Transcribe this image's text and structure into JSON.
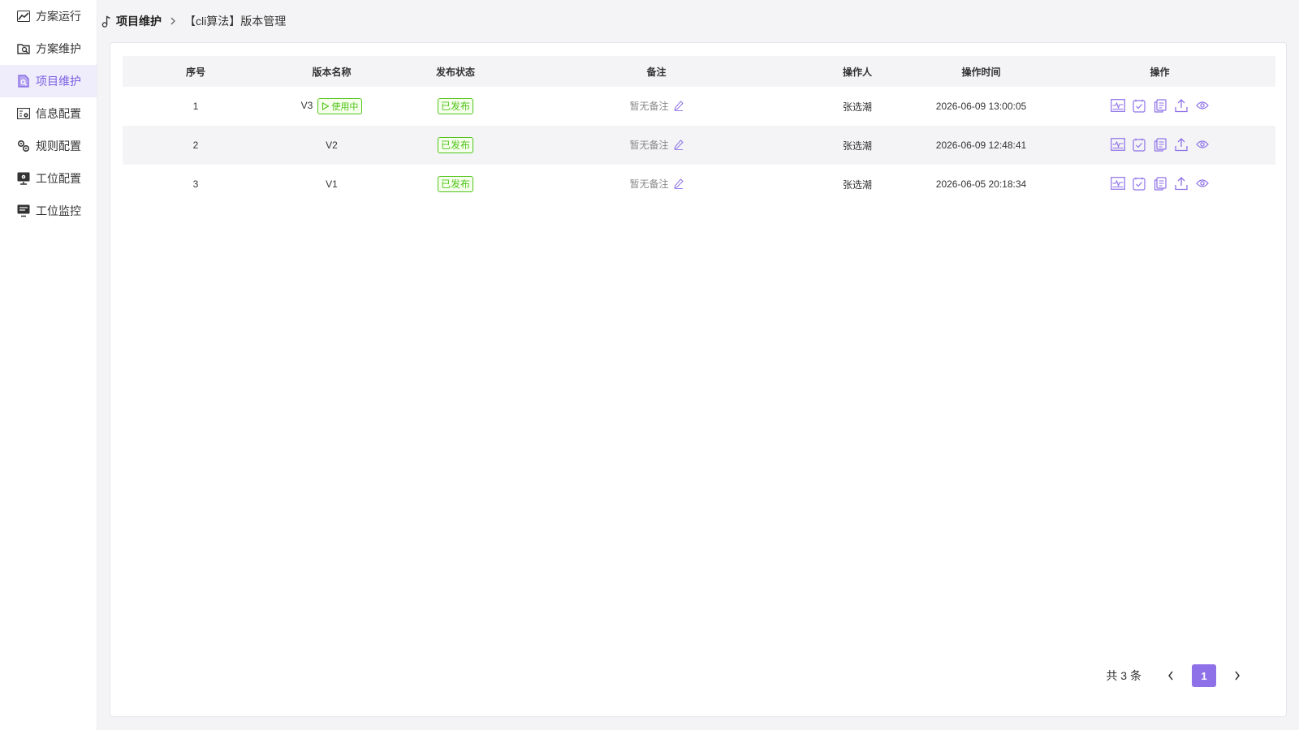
{
  "sidebar": {
    "items": [
      {
        "label": "方案运行",
        "icon": "chart-line-icon",
        "active": false
      },
      {
        "label": "方案维护",
        "icon": "folder-search-icon",
        "active": false
      },
      {
        "label": "项目维护",
        "icon": "document-search-icon",
        "active": true
      },
      {
        "label": "信息配置",
        "icon": "settings-board-icon",
        "active": false
      },
      {
        "label": "规则配置",
        "icon": "gears-icon",
        "active": false
      },
      {
        "label": "工位配置",
        "icon": "monitor-gear-icon",
        "active": false
      },
      {
        "label": "工位监控",
        "icon": "monitor-list-icon",
        "active": false
      }
    ]
  },
  "breadcrumb": {
    "parent": "项目维护",
    "current": "【cli算法】版本管理"
  },
  "table": {
    "headers": [
      "序号",
      "版本名称",
      "发布状态",
      "备注",
      "操作人",
      "操作时间",
      "操作"
    ],
    "rows": [
      {
        "seq": "1",
        "name": "V3",
        "badge": "使用中",
        "status": "已发布",
        "note": "暂无备注",
        "operator": "张选潮",
        "time": "2026-06-09 13:00:05"
      },
      {
        "seq": "2",
        "name": "V2",
        "badge": "",
        "status": "已发布",
        "note": "暂无备注",
        "operator": "张选潮",
        "time": "2026-06-09 12:48:41"
      },
      {
        "seq": "3",
        "name": "V1",
        "badge": "",
        "status": "已发布",
        "note": "暂无备注",
        "operator": "张选潮",
        "time": "2026-06-05 20:18:34"
      }
    ],
    "actions": [
      "chart-board-icon",
      "checklist-icon",
      "copy-icon",
      "upload-icon",
      "eye-icon"
    ]
  },
  "pagination": {
    "total_text": "共 3 条",
    "current_page": "1"
  },
  "colors": {
    "accent": "#7b5fe3",
    "success": "#52c41a",
    "icon": "#8e71e8"
  }
}
